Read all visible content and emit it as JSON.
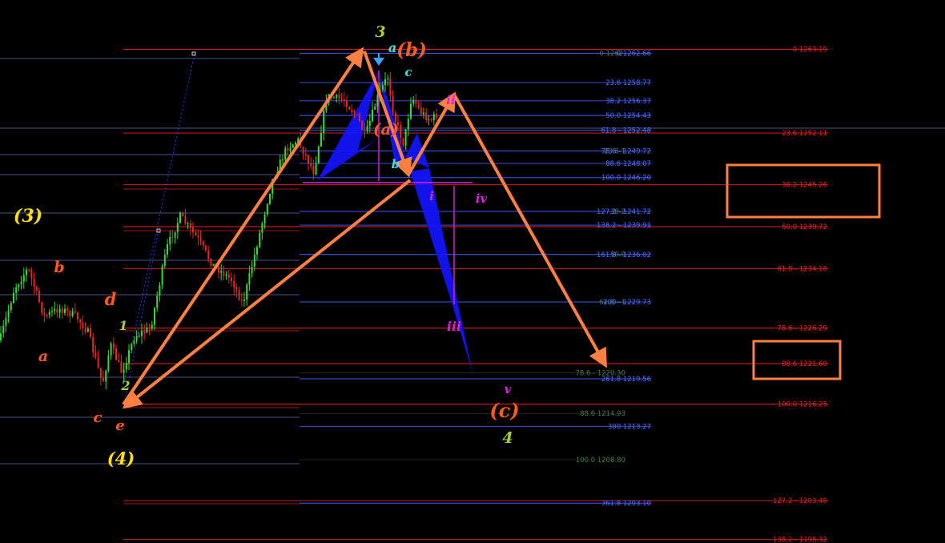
{
  "chart_data": {
    "type": "candlestick",
    "annotation_overlay": true,
    "colors": {
      "background": "#000000",
      "bull_candle": "#33dd33",
      "bear_candle": "#ee2222",
      "fib_primary": "#ee2020",
      "fib_secondary": "#3a5cff",
      "fib_faded": "#4a7a4a",
      "pattern_arrow": "#ff8040",
      "harmonic_fill": "#1414ff",
      "wave_orange": "#ff5a1a",
      "wave_yellow": "#ffe000",
      "wave_green": "#a8d030",
      "wave_cyan": "#40e0e0",
      "wave_magenta": "#e020e0"
    },
    "fib_levels_right": [
      {
        "label": "0 1263.19",
        "price": 1263.19
      },
      {
        "label": "23.6 1252.11",
        "price": 1252.11
      },
      {
        "label": "38.2 1245.26",
        "price": 1245.26
      },
      {
        "label": "50.0 1239.72",
        "price": 1239.72
      },
      {
        "label": "61.8 - 1234.18",
        "price": 1234.18
      },
      {
        "label": "78.6 - 1226.29",
        "price": 1226.29
      },
      {
        "label": "88.6 1221.60",
        "price": 1221.6
      },
      {
        "label": "100.0 1216.25",
        "price": 1216.25
      },
      {
        "label": "127.2 - 1203.48",
        "price": 1203.48
      },
      {
        "label": "138.2 - 1198.32",
        "price": 1198.32
      }
    ],
    "fib_levels_mid": [
      {
        "label": "0 1262.66",
        "price": 1262.66
      },
      {
        "label": "23.6 1258.77",
        "price": 1258.77
      },
      {
        "label": "38.2 1256.37",
        "price": 1256.37
      },
      {
        "label": "50.0 1254.43",
        "price": 1254.43
      },
      {
        "label": "61.8 - 1252.48",
        "price": 1252.48
      },
      {
        "label": "78.6 - 1249.72",
        "price": 1249.72
      },
      {
        "label": "88.6 1248.07",
        "price": 1248.07
      },
      {
        "label": "100.0 1246.20",
        "price": 1246.2
      },
      {
        "label": "127.2 - 1241.72",
        "price": 1241.72
      },
      {
        "label": "138.2 - 1239.91",
        "price": 1239.91
      },
      {
        "label": "161.8 - 1236.02",
        "price": 1236.02
      },
      {
        "label": "200 - 1229.73",
        "price": 1229.73
      },
      {
        "label": "261.8 1219.56",
        "price": 1219.56
      },
      {
        "label": "300 1213.27",
        "price": 1213.27
      },
      {
        "label": "361.8 1203.10",
        "price": 1203.1
      }
    ],
    "fib_levels_faded": [
      {
        "label": "0 1262.",
        "price": 1262.66
      },
      {
        "label": "23.6 1",
        "price": 1249.72
      },
      {
        "label": "38.2",
        "price": 1241.72
      },
      {
        "label": "50.0",
        "price": 1236.02
      },
      {
        "label": "61.8 - 1",
        "price": 1229.73
      },
      {
        "label": "78.6 - 1220.30",
        "price": 1220.3
      },
      {
        "label": "88.6 1214.93",
        "price": 1214.93
      },
      {
        "label": "100.0 1208.80",
        "price": 1208.8
      }
    ],
    "highlighted_levels": [
      "38.2 1245.26",
      "88.6 1221.60"
    ],
    "wave_labels": [
      {
        "text": "(3)",
        "color": "#ffe000"
      },
      {
        "text": "b",
        "color": "#ff5a1a"
      },
      {
        "text": "a",
        "color": "#ff5a1a"
      },
      {
        "text": "d",
        "color": "#ff5a1a"
      },
      {
        "text": "1",
        "color": "#a8d030"
      },
      {
        "text": "2",
        "color": "#a8d030"
      },
      {
        "text": "c",
        "color": "#ff5a1a"
      },
      {
        "text": "e",
        "color": "#ff5a1a"
      },
      {
        "text": "(4)",
        "color": "#ffe000"
      },
      {
        "text": "3",
        "color": "#a8d030"
      },
      {
        "text": "a",
        "color": "#40e0e0"
      },
      {
        "text": "(b)",
        "color": "#ff5a1a"
      },
      {
        "text": "c",
        "color": "#40e0e0"
      },
      {
        "text": "(a)",
        "color": "#ff5a1a"
      },
      {
        "text": "b",
        "color": "#40e0e0"
      },
      {
        "text": "i",
        "color": "#e020e0"
      },
      {
        "text": "ii",
        "color": "#e020e0"
      },
      {
        "text": "iv",
        "color": "#e020e0"
      },
      {
        "text": "iii",
        "color": "#e020e0"
      },
      {
        "text": "v",
        "color": "#e020e0"
      },
      {
        "text": "(c)",
        "color": "#ff5a1a"
      },
      {
        "text": "4",
        "color": "#a8d030"
      }
    ]
  }
}
